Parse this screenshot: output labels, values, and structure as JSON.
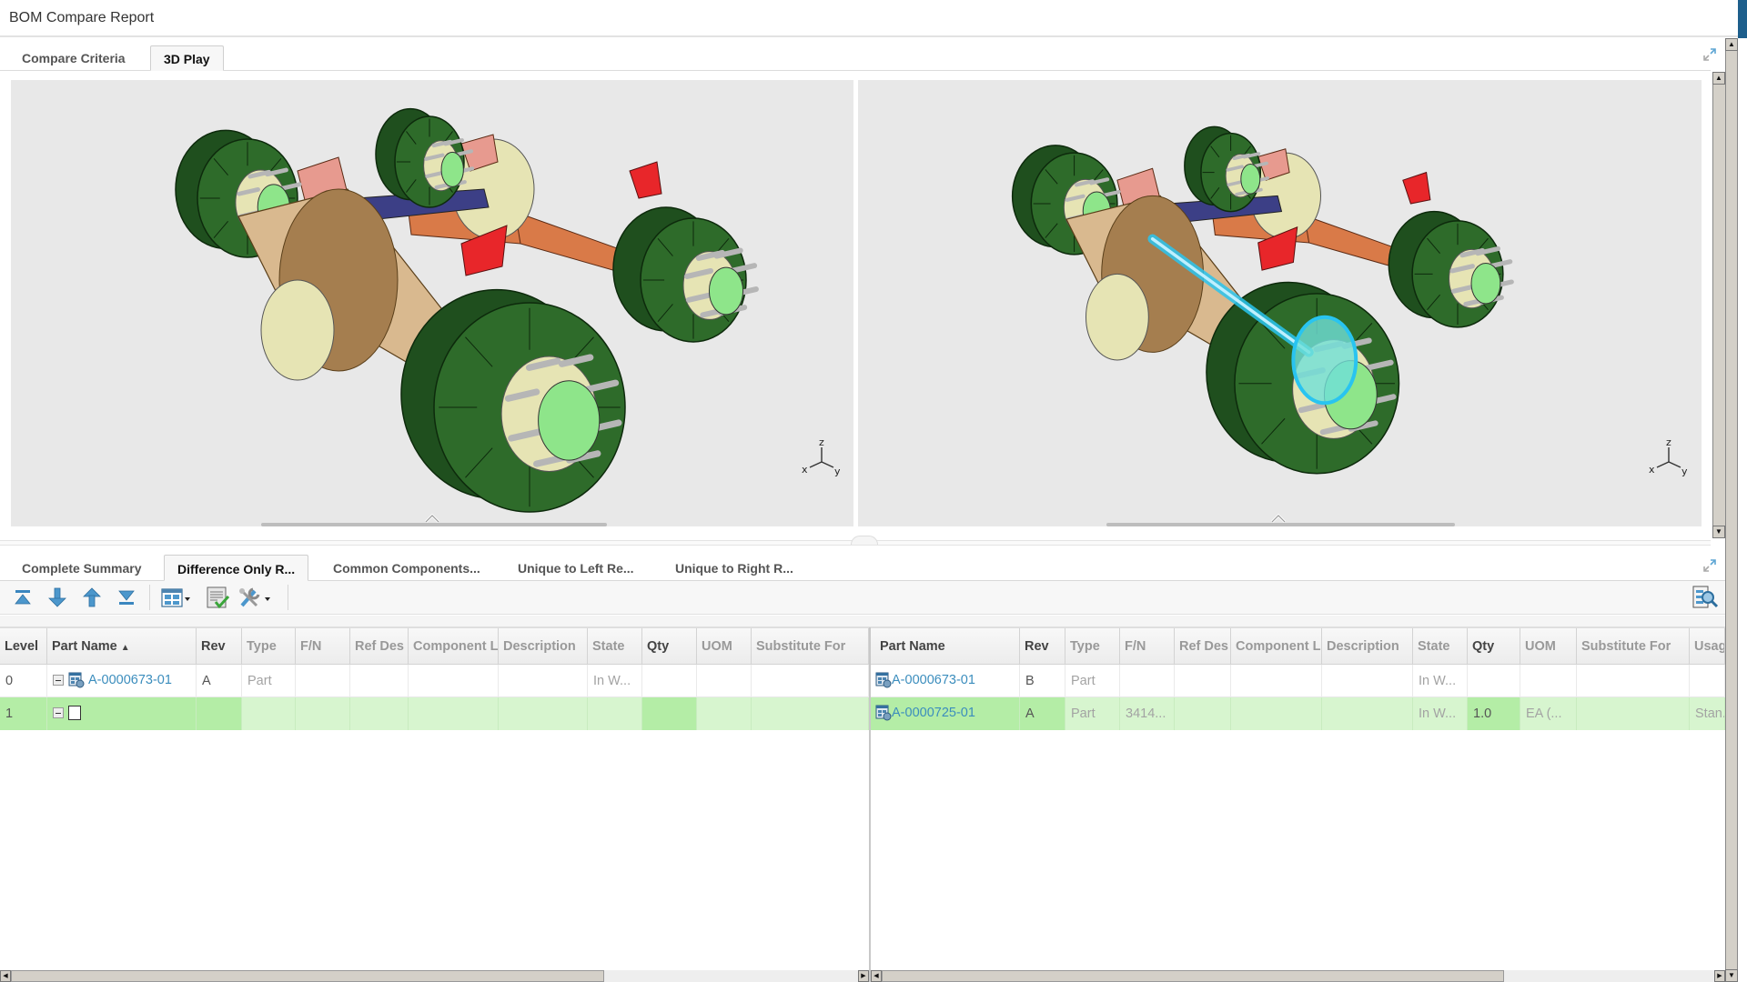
{
  "window": {
    "title": "BOM Compare Report"
  },
  "top_tabs": [
    {
      "label": "Compare Criteria",
      "active": false
    },
    {
      "label": "3D Play",
      "active": true
    }
  ],
  "viewers": {
    "left": {
      "name": "left-3d-viewer",
      "triad": {
        "x": "x",
        "y": "y",
        "z": "z"
      },
      "highlighted_part": null
    },
    "right": {
      "name": "right-3d-viewer",
      "triad": {
        "x": "x",
        "y": "y",
        "z": "z"
      },
      "highlighted_part": "axle shaft (cyan highlight)"
    },
    "colors": {
      "drum": "#2e6b2a",
      "drum_dark": "#1f4f1e",
      "hub": "#e6e4b4",
      "hub_face": "#8ee58a",
      "axle_front": "#d9b98f",
      "axle_front_dark": "#a57e4f",
      "axle_rear": "#d97a48",
      "bracket_red": "#e8262a",
      "bracket_pink": "#e79a8f",
      "navy": "#3c3f86",
      "stud": "#b6b6b6",
      "highlight": "#29c4f0"
    }
  },
  "bottom_tabs": [
    {
      "label": "Complete Summary",
      "active": false
    },
    {
      "label": "Difference Only R...",
      "active": true
    },
    {
      "label": "Common Components...",
      "active": false
    },
    {
      "label": "Unique to Left Re...",
      "active": false
    },
    {
      "label": "Unique to Right R...",
      "active": false
    }
  ],
  "toolbar": {
    "buttons": [
      {
        "name": "first-difference-button",
        "icon": "jump-to-top-icon"
      },
      {
        "name": "next-difference-button",
        "icon": "arrow-down-icon"
      },
      {
        "name": "previous-difference-button",
        "icon": "arrow-up-icon"
      },
      {
        "name": "last-difference-button",
        "icon": "jump-to-bottom-icon"
      },
      {
        "name": "column-layout-button",
        "icon": "table-layout-icon"
      },
      {
        "name": "apply-button",
        "icon": "checklist-icon"
      },
      {
        "name": "tools-button",
        "icon": "tools-icon"
      }
    ],
    "find_icon": "find-in-table-icon"
  },
  "left_grid": {
    "columns": [
      "Level",
      "Part Name",
      "Rev",
      "Type",
      "F/N",
      "Ref Des",
      "Component L",
      "Description",
      "State",
      "Qty",
      "UOM",
      "Substitute For"
    ],
    "sort": {
      "column": "Part Name",
      "direction": "ascending",
      "indicator": "▲"
    },
    "rows": [
      {
        "Level": "0",
        "Part Name": "A-0000673-01",
        "Rev": "A",
        "Type": "Part",
        "F/N": "",
        "Ref Des": "",
        "Component L": "",
        "Description": "",
        "State": "In W...",
        "Qty": "",
        "UOM": "",
        "Substitute For": "",
        "highlight": false
      },
      {
        "Level": "1",
        "Part Name": "",
        "Rev": "",
        "Type": "",
        "F/N": "",
        "Ref Des": "",
        "Component L": "",
        "Description": "",
        "State": "",
        "Qty": "",
        "UOM": "",
        "Substitute For": "",
        "highlight": true
      }
    ]
  },
  "right_grid": {
    "columns": [
      "Part Name",
      "Rev",
      "Type",
      "F/N",
      "Ref Des",
      "Component L",
      "Description",
      "State",
      "Qty",
      "UOM",
      "Substitute For",
      "Usag"
    ],
    "rows": [
      {
        "Part Name": "A-0000673-01",
        "Rev": "B",
        "Type": "Part",
        "F/N": "",
        "Ref Des": "",
        "Component L": "",
        "Description": "",
        "State": "In W...",
        "Qty": "",
        "UOM": "",
        "Substitute For": "",
        "Usag": "",
        "highlight": false
      },
      {
        "Part Name": "A-0000725-01",
        "Rev": "A",
        "Type": "Part",
        "F/N": "3414...",
        "Ref Des": "",
        "Component L": "",
        "Description": "",
        "State": "In W...",
        "Qty": "1.0",
        "UOM": "EA (...",
        "Substitute For": "",
        "Usag": "Stan...",
        "highlight": true
      }
    ]
  },
  "colors": {
    "link": "#3b8dbd",
    "diff_row": "#d7f5cf",
    "diff_cell_strong": "#b4eda6",
    "title_accent": "#1e5f8c"
  }
}
